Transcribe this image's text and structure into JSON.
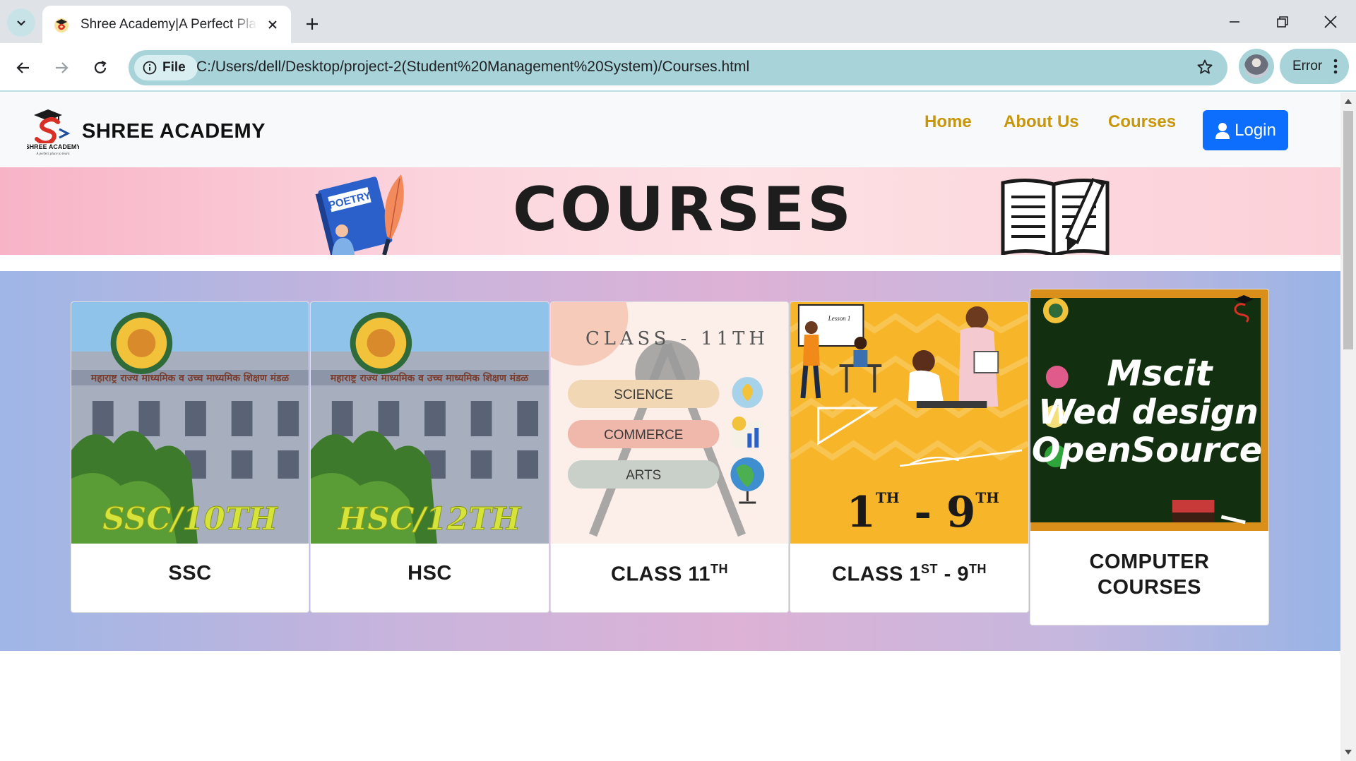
{
  "browser": {
    "tab_title": "Shree Academy|A Perfect Place",
    "url_scheme_label": "File",
    "url": "C:/Users/dell/Desktop/project-2(Student%20Management%20System)/Courses.html",
    "profile_status": "Error"
  },
  "site": {
    "brand_name": "SHREE ACADEMY",
    "logo_text": "SHREE ACADEMY",
    "logo_tagline": "A perfect place to learn",
    "nav": {
      "home": "Home",
      "about": "About Us",
      "courses": "Courses",
      "login": "Login"
    },
    "banner_title": "COURSES",
    "banner_book_label": "POETRY"
  },
  "courses": [
    {
      "title": "SSC",
      "image_caption": "SSC/10TH",
      "image_signboard": "महाराष्ट्र राज्य माध्यमिक व उच्च माध्यमिक शिक्षण मंडळ"
    },
    {
      "title": "HSC",
      "image_caption": "HSC/12TH",
      "image_signboard": "महाराष्ट्र राज्य माध्यमिक व उच्च माध्यमिक शिक्षण मंडळ"
    },
    {
      "title": "CLASS 11",
      "title_sup": "TH",
      "image_heading": "CLASS - 11TH",
      "streams": [
        "SCIENCE",
        "COMMERCE",
        "ARTS"
      ]
    },
    {
      "title_main": "CLASS 1",
      "title_sup1": "ST",
      "title_mid": " - 9",
      "title_sup2": "TH",
      "image_range": "1",
      "image_range_sup1": "TH",
      "image_range_mid": " - 9",
      "image_range_sup2": "TH",
      "image_board": "Lesson 1"
    },
    {
      "title_line1": "COMPUTER",
      "title_line2": "COURSES",
      "image_items": [
        "Mscit",
        "Wed design",
        "OpenSource"
      ]
    }
  ],
  "colors": {
    "nav_link": "#c8960a",
    "login_button": "#0d6efd",
    "omnibox": "#a8d4d9"
  }
}
